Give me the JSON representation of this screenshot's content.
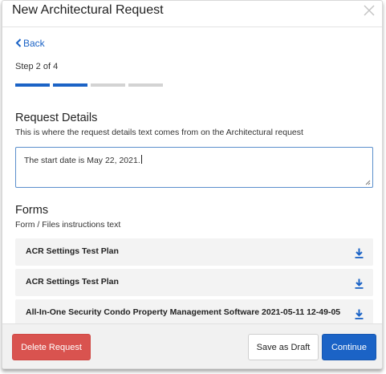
{
  "modal": {
    "title": "New Architectural Request",
    "close_icon": "close-icon"
  },
  "nav": {
    "back_label": "Back",
    "back_icon": "chevron-left-icon"
  },
  "steps": {
    "label": "Step 2 of 4",
    "current": 2,
    "total": 4,
    "active_color": "#1b63c6",
    "inactive_color": "#d3d3d3"
  },
  "request_details": {
    "title": "Request Details",
    "subtitle": "This is where the request details text comes from on the Architectural request",
    "value": "The start date is May 22, 2021."
  },
  "forms": {
    "title": "Forms",
    "subtitle": "Form / Files instructions text",
    "items": [
      {
        "label": "ACR Settings Test Plan",
        "icon": "download-icon"
      },
      {
        "label": "ACR Settings Test Plan",
        "icon": "download-icon"
      },
      {
        "label": "All-In-One Security Condo Property Management Software 2021-05-11 12-49-05",
        "icon": "download-icon"
      }
    ]
  },
  "footer": {
    "delete_label": "Delete Request",
    "draft_label": "Save as Draft",
    "continue_label": "Continue"
  },
  "colors": {
    "primary": "#1b63c6",
    "danger": "#d9534f"
  }
}
